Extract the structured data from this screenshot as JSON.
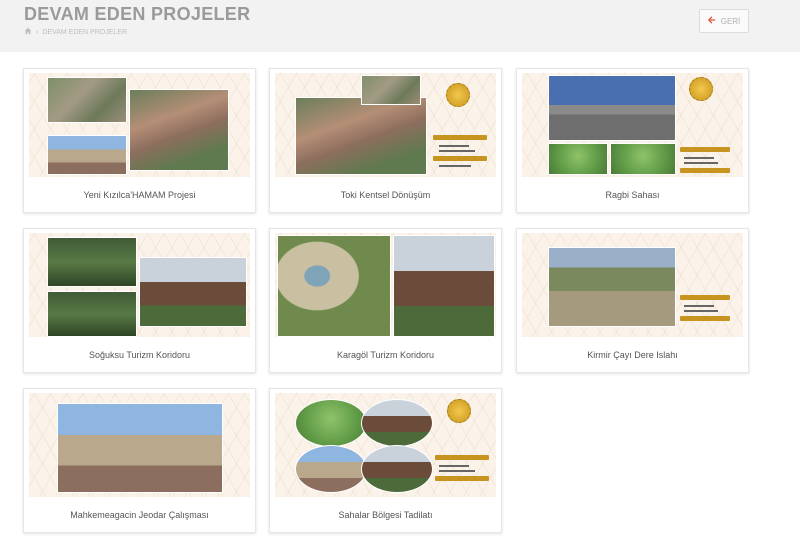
{
  "header": {
    "title": "DEVAM EDEN PROJELER",
    "breadcrumb_current": "DEVAM EDEN PROJELER",
    "back_label": "GERİ"
  },
  "colors": {
    "accent": "#c89420",
    "back_icon": "#e0583a"
  },
  "projects": [
    {
      "title": "Yeni Kızılca'HAMAM Projesi"
    },
    {
      "title": "Toki Kentsel Dönüşüm"
    },
    {
      "title": "Ragbi Sahası"
    },
    {
      "title": "Soğuksu Turizm Koridoru"
    },
    {
      "title": "Karagöl Turizm Koridoru"
    },
    {
      "title": "Kirmir Çayı Dere Islahı"
    },
    {
      "title": "Mahkemeagacin Jeodar Çalışması"
    },
    {
      "title": "Sahalar Bölgesi Tadilatı"
    }
  ]
}
